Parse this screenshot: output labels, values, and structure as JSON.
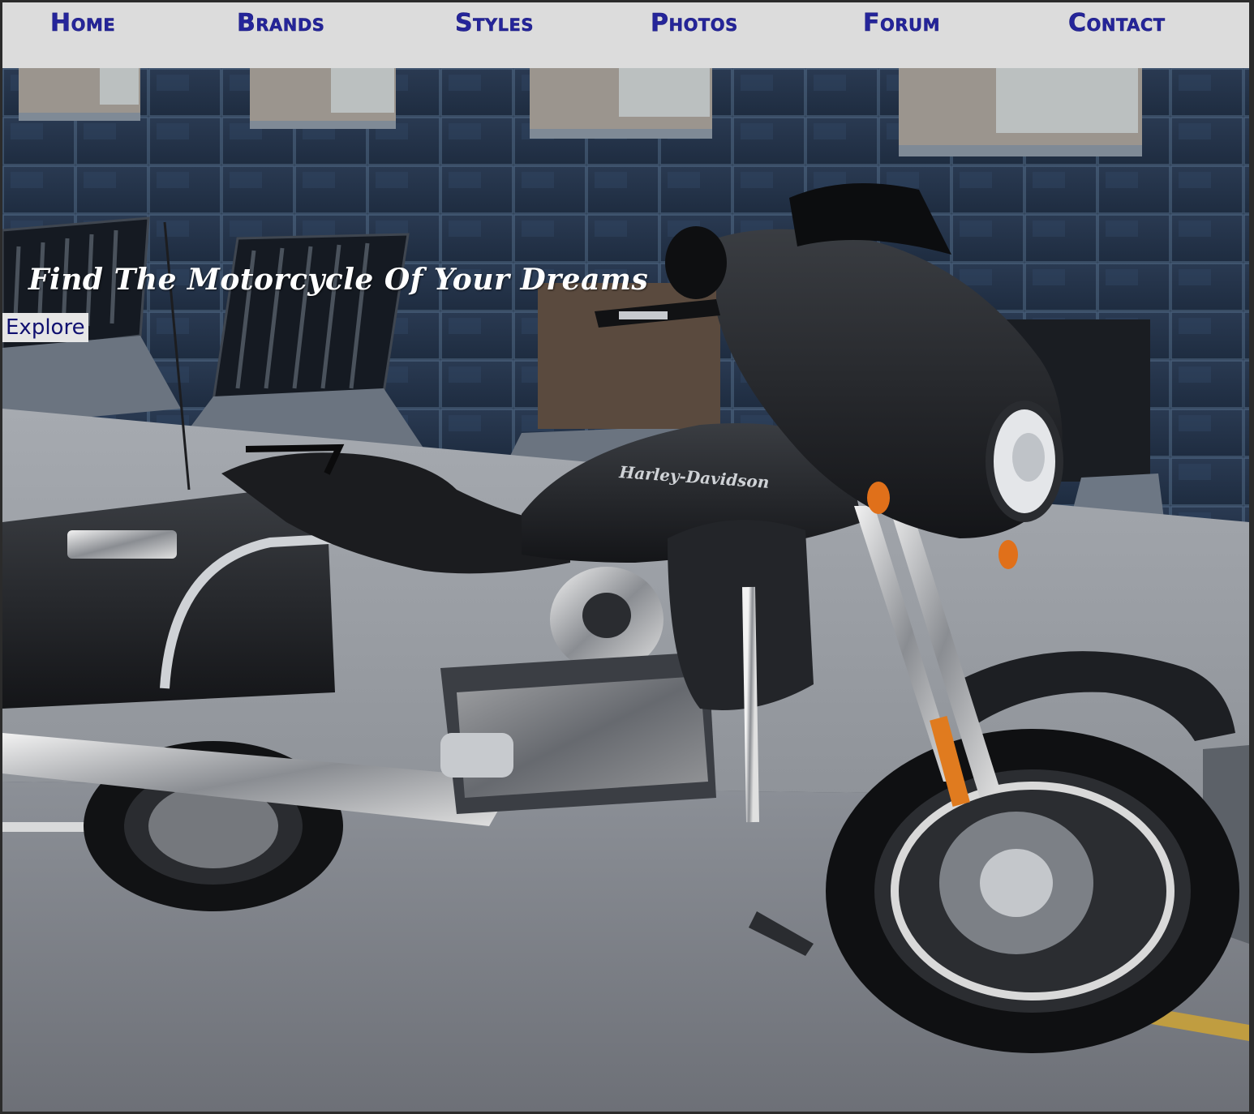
{
  "nav": {
    "items": [
      {
        "label": "Home"
      },
      {
        "label": "Brands"
      },
      {
        "label": "Styles"
      },
      {
        "label": "Photos"
      },
      {
        "label": "Forum"
      },
      {
        "label": "Contact"
      }
    ]
  },
  "hero": {
    "title": "Find The Motorcycle Of Your Dreams",
    "button_label": "Explore",
    "image_subject": "matte black Harley-Davidson touring motorcycle parked in front of a blue-tiled building",
    "tank_logo_text": "Harley-Davidson"
  },
  "colors": {
    "nav_background": "#dcdcdc",
    "nav_text": "#25259a",
    "button_background": "#e6e6e6",
    "button_text": "#101070",
    "title_text": "#ffffff"
  }
}
